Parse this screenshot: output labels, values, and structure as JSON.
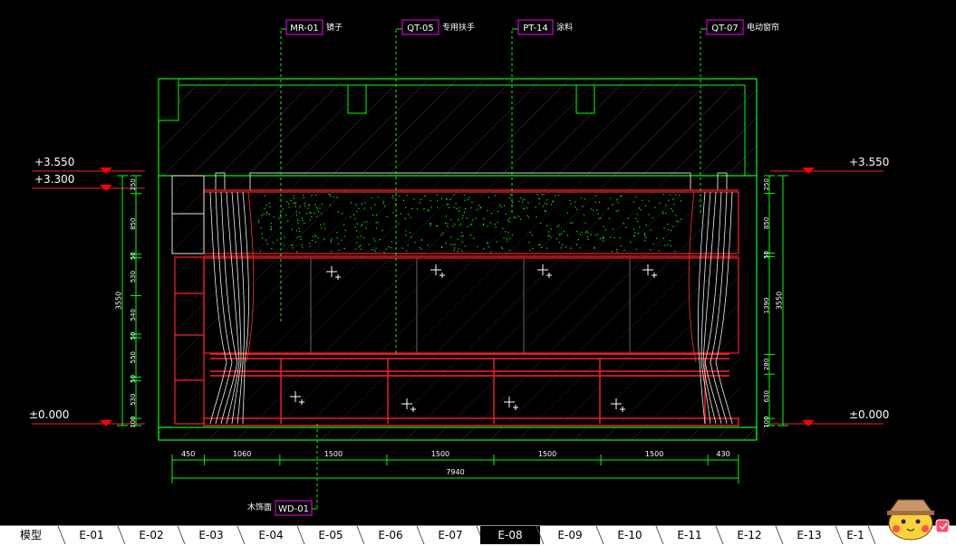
{
  "callouts_top": [
    {
      "code": "MR-01",
      "note": "镜子"
    },
    {
      "code": "QT-05",
      "note": "专用扶手"
    },
    {
      "code": "PT-14",
      "note": "涂料"
    },
    {
      "code": "QT-07",
      "note": "电动窗帘"
    }
  ],
  "callout_bottom": {
    "code": "WD-01",
    "note": "木饰面"
  },
  "levels_left": [
    "+3.550",
    "+3.300",
    "±0.000"
  ],
  "levels_right": [
    "+3.550",
    "±0.000"
  ],
  "dims_left_segments": [
    "250",
    "850",
    "50",
    "530",
    "540",
    "50",
    "550",
    "50",
    "530",
    "100"
  ],
  "dims_left_total": "3550",
  "dims_right_segments": [
    "250",
    "850",
    "50",
    "1390",
    "280",
    "630",
    "100"
  ],
  "dims_right_total": "3550",
  "dims_bottom_segments": [
    "450",
    "1060",
    "1500",
    "1500",
    "1500",
    "1500",
    "430"
  ],
  "dims_bottom_total": "7940",
  "layout_tabs": [
    "模型",
    "E-01",
    "E-02",
    "E-03",
    "E-04",
    "E-05",
    "E-06",
    "E-07",
    "E-08",
    "E-09",
    "E-10",
    "E-11",
    "E-12",
    "E-13",
    "E-1"
  ],
  "active_tab": "E-08",
  "colors": {
    "background": "#000000",
    "walls": "#00ff00",
    "furniture": "#ff2020",
    "curtain": "#ffffff",
    "dims": "#00ff00",
    "callout_box": "#ff00ff",
    "level_marker": "#ff0000",
    "text": "#ffffff"
  }
}
